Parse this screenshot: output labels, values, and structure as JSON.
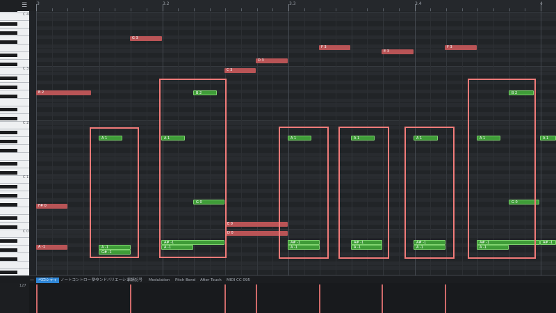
{
  "toolbar": {
    "menu_icon": "menu-icon"
  },
  "ruler": {
    "labels": [
      "3",
      "3.2",
      "3.3",
      "3.4",
      "4"
    ]
  },
  "keyboard": {
    "octave_labels": [
      "C 4",
      "C 3",
      "C 2",
      "C 1",
      "C 0"
    ]
  },
  "notes": [
    {
      "label": "G 3",
      "color": "red"
    },
    {
      "label": "F 3",
      "color": "red"
    },
    {
      "label": "E 3",
      "color": "red"
    },
    {
      "label": "F 3",
      "color": "red"
    },
    {
      "label": "D 3",
      "color": "red"
    },
    {
      "label": "C 3",
      "color": "red"
    },
    {
      "label": "B 2",
      "color": "red"
    },
    {
      "label": "B 2",
      "color": "green"
    },
    {
      "label": "B 2",
      "color": "green"
    },
    {
      "label": "A 1",
      "color": "green"
    },
    {
      "label": "A 1",
      "color": "green"
    },
    {
      "label": "A 1",
      "color": "green"
    },
    {
      "label": "A 1",
      "color": "green"
    },
    {
      "label": "A 1",
      "color": "green"
    },
    {
      "label": "A 1",
      "color": "green"
    },
    {
      "label": "A 1",
      "color": "green"
    },
    {
      "label": "F# 0",
      "color": "red"
    },
    {
      "label": "G 0",
      "color": "green"
    },
    {
      "label": "G 0",
      "color": "green"
    },
    {
      "label": "E 0",
      "color": "red"
    },
    {
      "label": "D 0",
      "color": "red"
    },
    {
      "label": "A -1",
      "color": "red"
    },
    {
      "label": "A -1",
      "color": "green"
    },
    {
      "label": "G# -1",
      "color": "green"
    },
    {
      "label": "A# -1",
      "color": "green"
    },
    {
      "label": "A -1",
      "color": "green"
    },
    {
      "label": "A# -1",
      "color": "green"
    },
    {
      "label": "A -1",
      "color": "green"
    },
    {
      "label": "A# -1",
      "color": "green"
    },
    {
      "label": "A -1",
      "color": "green"
    },
    {
      "label": "A# -1",
      "color": "green"
    },
    {
      "label": "A -1",
      "color": "green"
    },
    {
      "label": "A# -1",
      "color": "green"
    },
    {
      "label": "A -1",
      "color": "green"
    },
    {
      "label": "A# -1",
      "color": "green"
    }
  ],
  "lane_tabs": [
    {
      "label": "ベロシティ",
      "active": true
    },
    {
      "label": "ノートコントローラー",
      "active": false
    },
    {
      "label": "サウンドバリエーション",
      "active": false
    },
    {
      "label": "表情記号",
      "active": false
    },
    {
      "label": "Modulation",
      "active": false
    },
    {
      "label": "Pitch Bend",
      "active": false
    },
    {
      "label": "After Touch",
      "active": false
    },
    {
      "label": "MIDI CC 095",
      "active": false
    }
  ],
  "velocity": {
    "max_label": "127"
  },
  "colors": {
    "accent": "#2f86d6",
    "note_red": "#b95456",
    "note_green": "#3f9c38",
    "selection": "#f27b79"
  }
}
